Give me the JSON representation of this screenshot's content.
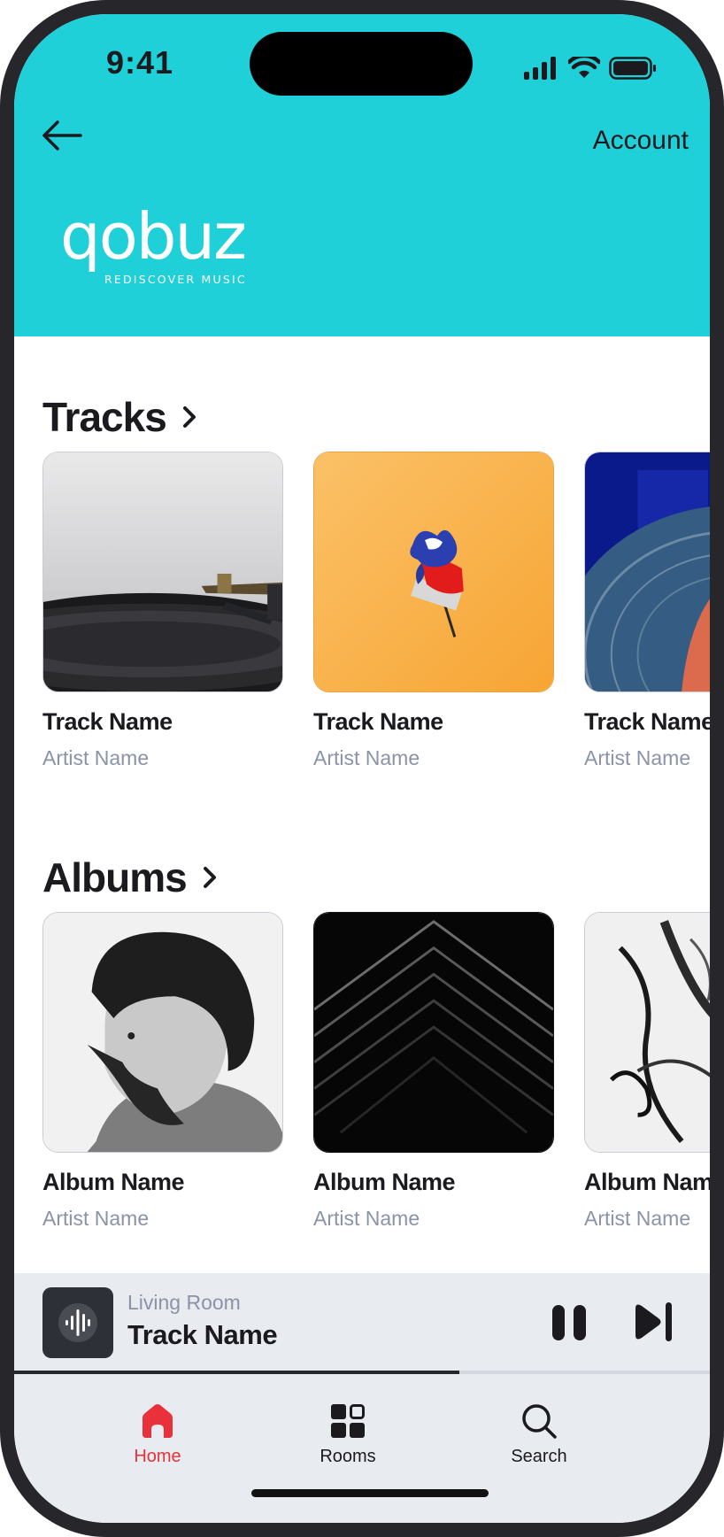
{
  "status_bar": {
    "time": "9:41"
  },
  "header": {
    "back_icon": "arrow-left-icon",
    "account_label": "Account",
    "logo_text": "qobuz",
    "logo_tagline": "REDISCOVER MUSIC",
    "background_color": "#1fd0d8"
  },
  "tracks": {
    "title": "Tracks",
    "items": [
      {
        "title": "Track Name",
        "artist": "Artist Name",
        "art": "turntable-photo"
      },
      {
        "title": "Track Name",
        "artist": "Artist Name",
        "art": "flower-on-orange"
      },
      {
        "title": "Track Name",
        "artist": "Artist Name",
        "art": "colored-vinyl"
      }
    ]
  },
  "albums": {
    "title": "Albums",
    "items": [
      {
        "title": "Album Name",
        "artist": "Artist Name",
        "art": "portrait-bw"
      },
      {
        "title": "Album Name",
        "artist": "Artist Name",
        "art": "dark-geometric"
      },
      {
        "title": "Album Name",
        "artist": "Artist Name",
        "art": "ink-abstract"
      }
    ]
  },
  "now_playing": {
    "room": "Living Room",
    "track": "Track Name",
    "progress": 0.64,
    "pause_icon": "pause-icon",
    "next_icon": "skip-next-icon"
  },
  "tabs": [
    {
      "label": "Home",
      "icon": "home-icon",
      "active": true
    },
    {
      "label": "Rooms",
      "icon": "rooms-grid-icon",
      "active": false
    },
    {
      "label": "Search",
      "icon": "search-icon",
      "active": false
    }
  ],
  "colors": {
    "accent": "#e8313a",
    "text": "#1b1b1f",
    "muted": "#8a93a8"
  }
}
